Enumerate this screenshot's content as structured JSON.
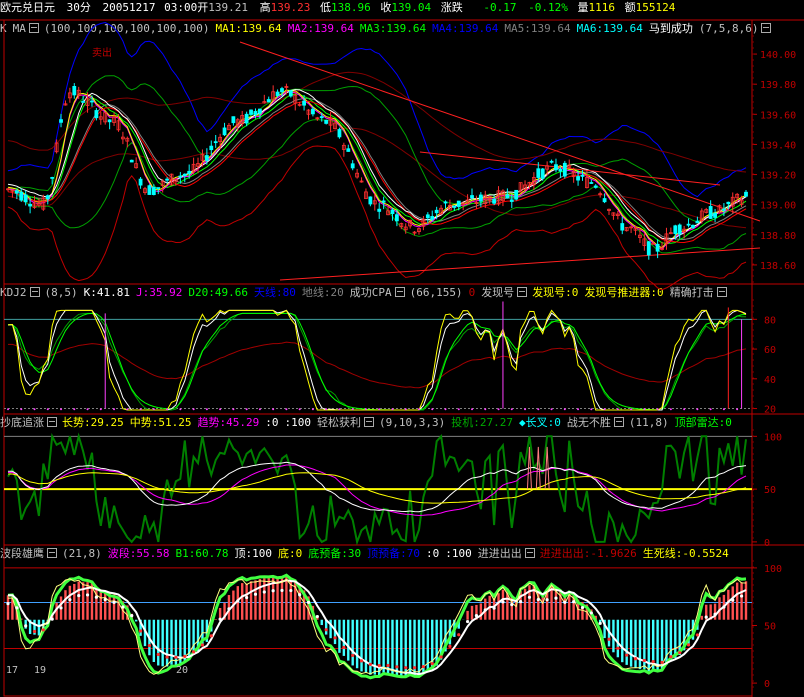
{
  "header": {
    "name": "欧元兑日元",
    "period": "30分",
    "date": "20051217",
    "time": "03:00",
    "open_label": "开",
    "open": "139.21",
    "high_label": "高",
    "high": "139.23",
    "low_label": "低",
    "low": "138.96",
    "close_label": "收",
    "close": "139.04",
    "change_label": "涨跌",
    "change": "-0.17",
    "change_pct": "-0.12%",
    "volume_label": "量",
    "volume": "1116",
    "amount_label": "额",
    "amount": "155124"
  },
  "panels": [
    {
      "id": "main",
      "items": [
        {
          "text": "K",
          "color": "#c0c0c0"
        },
        {
          "text": "MA",
          "color": "#c0c0c0",
          "checkbox": true
        },
        {
          "text": "(100,100,100,100,100,100)",
          "color": "#c0c0c0"
        },
        {
          "text": "MA1:139.64",
          "color": "#ffff00"
        },
        {
          "text": "MA2:139.64",
          "color": "#ff00ff"
        },
        {
          "text": "MA3:139.64",
          "color": "#00ff00"
        },
        {
          "text": "MA4:139.64",
          "color": "#0000ff"
        },
        {
          "text": "MA5:139.64",
          "color": "#808080"
        },
        {
          "text": "MA6:139.64",
          "color": "#00ffff"
        },
        {
          "text": "马到成功",
          "color": "#ffffff"
        },
        {
          "text": "(7,5,8,6)",
          "color": "#c0c0c0",
          "checkbox": true
        }
      ]
    },
    {
      "id": "kdj",
      "items": [
        {
          "text": "KDJ2",
          "color": "#c0c0c0",
          "checkbox": true
        },
        {
          "text": "(8,5)",
          "color": "#c0c0c0"
        },
        {
          "text": "K:41.81",
          "color": "#ffffff"
        },
        {
          "text": "J:35.92",
          "color": "#ff00ff"
        },
        {
          "text": "D20:49.66",
          "color": "#00ff00"
        },
        {
          "text": "天线:80",
          "color": "#0000ff"
        },
        {
          "text": "地线:20",
          "color": "#808080"
        },
        {
          "text": "成功CPA",
          "color": "#c0c0c0",
          "checkbox": true
        },
        {
          "text": "(66,155)",
          "color": "#c0c0c0"
        },
        {
          "text": "0",
          "color": "#c00000"
        },
        {
          "text": "发现号",
          "color": "#c0c0c0",
          "checkbox": true
        },
        {
          "text": "发现号:0",
          "color": "#ffff00"
        },
        {
          "text": "发现号推进器:0",
          "color": "#ffff00"
        },
        {
          "text": "精确打击",
          "color": "#c0c0c0",
          "checkbox": true
        }
      ]
    },
    {
      "id": "chaodi",
      "items": [
        {
          "text": "抄底追涨",
          "color": "#c0c0c0",
          "checkbox": true
        },
        {
          "text": "长势:29.25",
          "color": "#ffff00"
        },
        {
          "text": "中势:51.25",
          "color": "#ffff00"
        },
        {
          "text": "趋势:45.29",
          "color": "#ff00ff"
        },
        {
          "text": ":0",
          "color": "#ffffff"
        },
        {
          "text": ":100",
          "color": "#ffffff"
        },
        {
          "text": "轻松获利",
          "color": "#c0c0c0",
          "checkbox": true
        },
        {
          "text": "(9,10,3,3)",
          "color": "#c0c0c0"
        },
        {
          "text": "投机:27.27",
          "color": "#00aa00"
        },
        {
          "text": "◆长叉:0",
          "color": "#00ffff"
        },
        {
          "text": "战无不胜",
          "color": "#c0c0c0",
          "checkbox": true
        },
        {
          "text": "(11,8)",
          "color": "#c0c0c0"
        },
        {
          "text": "顶部雷达:0",
          "color": "#00ff00"
        }
      ]
    },
    {
      "id": "boduan",
      "items": [
        {
          "text": "波段雄鹰",
          "color": "#c0c0c0",
          "checkbox": true
        },
        {
          "text": "(21,8)",
          "color": "#c0c0c0"
        },
        {
          "text": "波段:55.58",
          "color": "#ff00ff"
        },
        {
          "text": "B1:60.78",
          "color": "#00ff00"
        },
        {
          "text": "顶:100",
          "color": "#ffffff"
        },
        {
          "text": "底:0",
          "color": "#ffff00"
        },
        {
          "text": "底预备:30",
          "color": "#00ff00"
        },
        {
          "text": "顶预备:70",
          "color": "#0000ff"
        },
        {
          "text": ":0",
          "color": "#ffffff"
        },
        {
          "text": ":100",
          "color": "#ffffff"
        },
        {
          "text": "进进出出",
          "color": "#c0c0c0",
          "checkbox": true
        },
        {
          "text": "进进出出:-1.9626",
          "color": "#c00000"
        },
        {
          "text": "生死线:-0.5524",
          "color": "#ffff00"
        }
      ]
    }
  ],
  "annotations": {
    "sell_label": "卖出"
  },
  "time_labels": [
    "17",
    "19",
    "20"
  ],
  "chart_data": [
    {
      "type": "candlestick",
      "panel": "main",
      "yticks": [
        138.6,
        138.8,
        139.0,
        139.2,
        139.4,
        139.6,
        139.8,
        140.0
      ],
      "ylim": [
        138.48,
        140.12
      ],
      "keypoints": [
        [
          0,
          139.1
        ],
        [
          8,
          139.0
        ],
        [
          14,
          139.75
        ],
        [
          24,
          139.55
        ],
        [
          32,
          139.1
        ],
        [
          40,
          139.2
        ],
        [
          52,
          139.55
        ],
        [
          62,
          139.75
        ],
        [
          72,
          139.55
        ],
        [
          84,
          139.0
        ],
        [
          92,
          138.85
        ],
        [
          100,
          139.0
        ],
        [
          112,
          139.05
        ],
        [
          124,
          139.25
        ],
        [
          132,
          139.15
        ],
        [
          140,
          138.85
        ],
        [
          146,
          138.7
        ],
        [
          152,
          138.85
        ],
        [
          160,
          138.95
        ],
        [
          167,
          139.05
        ]
      ],
      "volatility": 0.09
    },
    {
      "type": "line",
      "panel": "kdj",
      "yticks": [
        20,
        40,
        60,
        80
      ],
      "ylim": [
        17,
        93
      ]
    },
    {
      "type": "line",
      "panel": "chaodi",
      "yticks": [
        0,
        50,
        100
      ],
      "ylim": [
        -2,
        106
      ]
    },
    {
      "type": "bar",
      "panel": "boduan",
      "yticks": [
        0,
        50,
        100
      ],
      "ylim": [
        -6,
        106
      ]
    }
  ]
}
